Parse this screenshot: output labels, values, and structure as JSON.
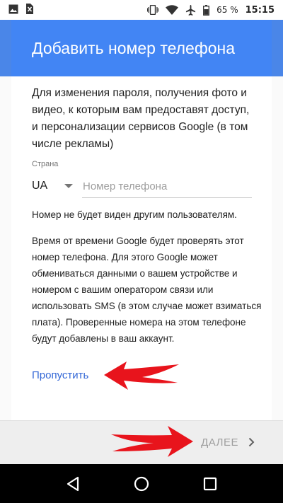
{
  "status_bar": {
    "battery_percent": "65 %",
    "time": "15:15",
    "icons": [
      "image-icon",
      "sim-off-icon",
      "vibrate-icon",
      "wifi-icon",
      "airplane-icon",
      "battery-icon"
    ]
  },
  "app_bar": {
    "title": "Добавить номер телефона",
    "color": "#4285f4"
  },
  "form": {
    "description": "Для изменения пароля, получения фото и видео, к которым вам предоставят доступ, и персонализации сервисов Google (в том числе рекламы)",
    "country_label": "Страна",
    "country_value": "UA",
    "phone_placeholder": "Номер телефона",
    "phone_value": "",
    "note_hidden": "Номер не будет виден другим пользователям.",
    "note_verify": "Время от времени Google будет проверять этот номер телефона. Для этого Google может обмениваться данными о вашем устройстве и номером с вашим оператором связи или использовать SMS (в этом случае может взиматься плата). Проверенные номера на этом телефоне будут добавлены в ваш аккаунт.",
    "skip_label": "Пропустить"
  },
  "footer": {
    "next_label": "ДАЛЕЕ"
  },
  "annotations": {
    "arrow_color": "#e8141c"
  },
  "nav_bar": {
    "icons": [
      "back-icon",
      "home-icon",
      "recents-icon"
    ]
  }
}
